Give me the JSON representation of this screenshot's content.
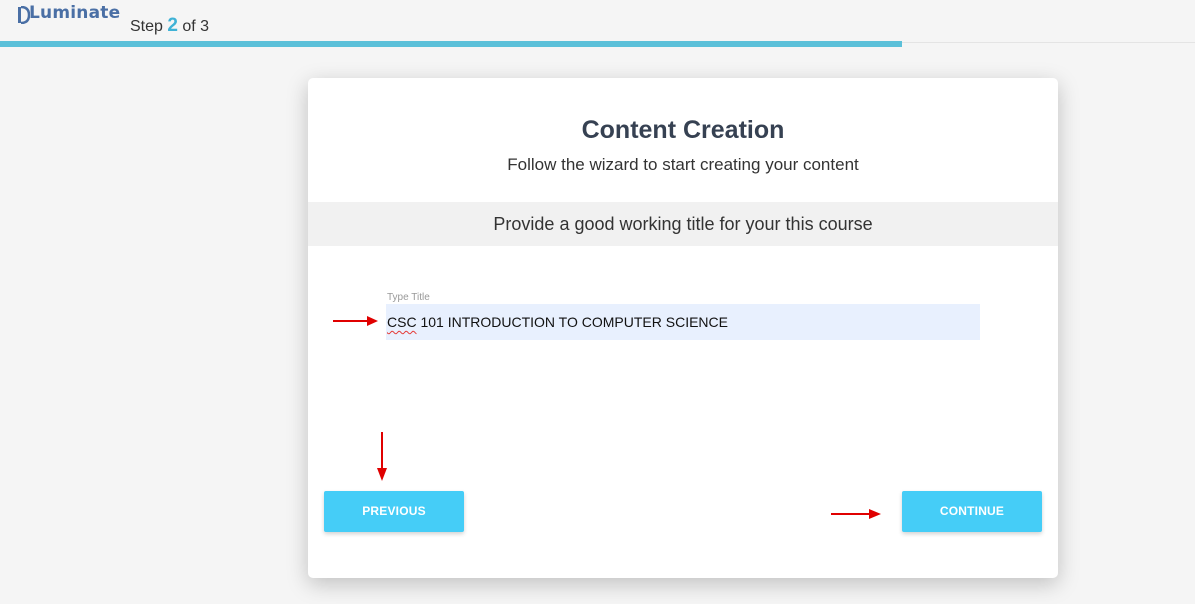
{
  "header": {
    "logo_text": "Luminate",
    "step_prefix": "Step ",
    "step_current": "2",
    "step_suffix": " of 3",
    "progress_fraction": 0.755
  },
  "card": {
    "title": "Content Creation",
    "subtitle": "Follow the wizard to start creating your content",
    "prompt": "Provide a good working title for your this course",
    "field": {
      "label": "Type Title",
      "value_misspelled_part": "CSC",
      "value_rest": " 101 INTRODUCTION TO COMPUTER SCIENCE"
    },
    "buttons": {
      "previous": "PREVIOUS",
      "continue": "CONTINUE"
    }
  },
  "colors": {
    "accent": "#45cdf7",
    "progress": "#5bc0d9",
    "annotation_arrow": "#e00000"
  },
  "annotations": {
    "icons": [
      "arrow-right-icon",
      "arrow-down-icon",
      "arrow-right-icon"
    ]
  }
}
